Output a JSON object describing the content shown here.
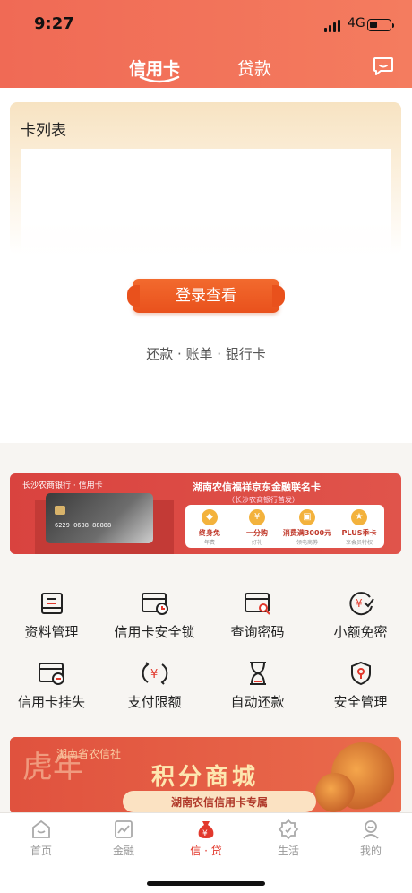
{
  "status_bar": {
    "time": "9:27",
    "network": "4G"
  },
  "header": {
    "tabs": [
      {
        "label": "信用卡",
        "active": true
      },
      {
        "label": "贷款",
        "active": false
      }
    ],
    "message_icon": "chat-bubble-icon"
  },
  "card_list": {
    "title": "卡列表",
    "login_button": "登录查看",
    "sub_links": "还款 · 账单 · 银行卡"
  },
  "promo_banner": {
    "bank_logo": "长沙农商银行 · 信用卡",
    "title": "湖南农信福祥京东金融联名卡",
    "subtitle": "（长沙农商银行首发）",
    "card_number": "6229 0688 88888",
    "perks": [
      {
        "name": "终身免",
        "desc": "年费"
      },
      {
        "name": "一分购",
        "desc": "好礼"
      },
      {
        "name": "消费满3000元",
        "desc": "领电商券"
      },
      {
        "name": "PLUS季卡",
        "desc": "享会员特权"
      }
    ]
  },
  "services": [
    {
      "label": "资料管理",
      "icon": "profile-doc-icon"
    },
    {
      "label": "信用卡安全锁",
      "icon": "card-lock-icon"
    },
    {
      "label": "查询密码",
      "icon": "card-search-icon"
    },
    {
      "label": "小额免密",
      "icon": "yuan-check-icon"
    },
    {
      "label": "信用卡挂失",
      "icon": "card-minus-icon"
    },
    {
      "label": "支付限额",
      "icon": "yuan-limit-icon"
    },
    {
      "label": "自动还款",
      "icon": "hourglass-icon"
    },
    {
      "label": "安全管理",
      "icon": "shield-icon"
    }
  ],
  "mall_banner": {
    "org": "湖南省农信社",
    "title": "积分商城",
    "subtitle": "湖南农信信用卡专属",
    "calligraphy": "虎年"
  },
  "bottom_nav": [
    {
      "label": "首页",
      "icon": "home-icon",
      "active": false
    },
    {
      "label": "金融",
      "icon": "finance-chart-icon",
      "active": false
    },
    {
      "label": "信 · 贷",
      "icon": "money-bag-icon",
      "active": true
    },
    {
      "label": "生活",
      "icon": "life-badge-icon",
      "active": false
    },
    {
      "label": "我的",
      "icon": "user-icon",
      "active": false
    }
  ],
  "colors": {
    "brand": "#f06a55",
    "accent": "#e9511c",
    "active_nav": "#e2382c"
  }
}
